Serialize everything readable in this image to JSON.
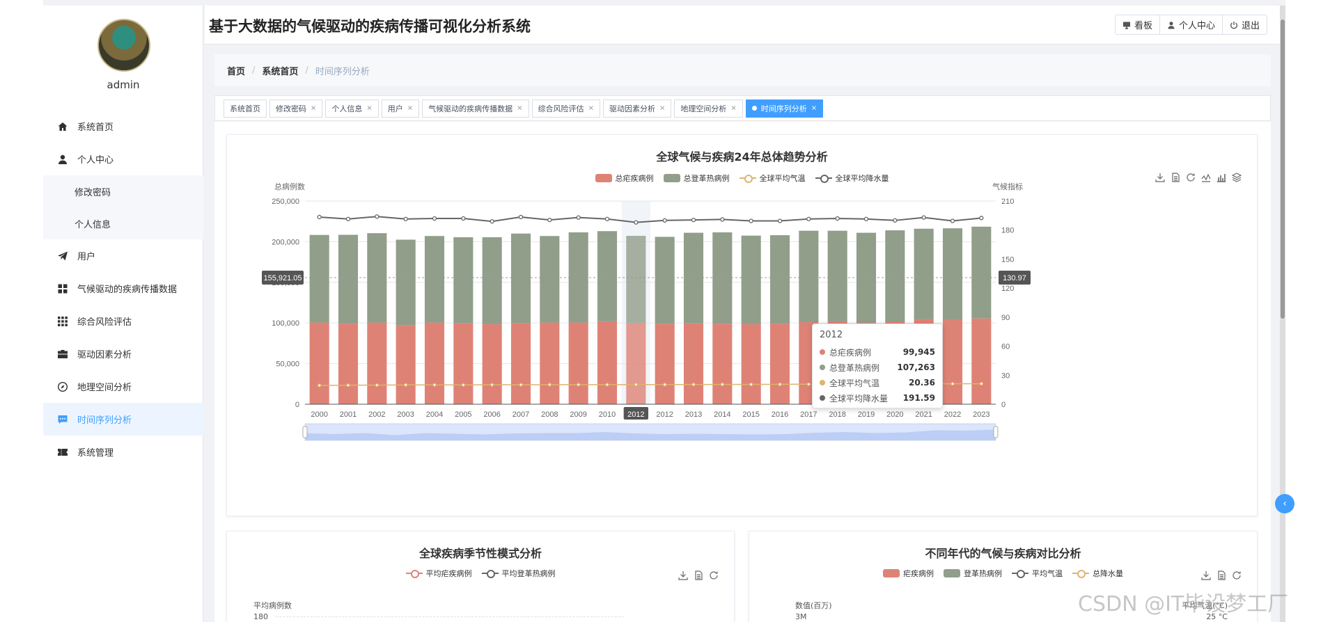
{
  "app": {
    "title": "基于大数据的气候驱动的疾病传播可视化分析系统",
    "username": "admin"
  },
  "header_buttons": [
    {
      "label": "看板",
      "icon": "monitor-icon"
    },
    {
      "label": "个人中心",
      "icon": "user-icon"
    },
    {
      "label": "退出",
      "icon": "power-icon"
    }
  ],
  "sidebar": {
    "items": [
      {
        "label": "系统首页",
        "icon": "home-icon"
      },
      {
        "label": "个人中心",
        "icon": "user-icon"
      },
      {
        "label": "修改密码",
        "sub": true
      },
      {
        "label": "个人信息",
        "sub": true
      },
      {
        "label": "用户",
        "icon": "send-icon"
      },
      {
        "label": "气候驱动的疾病传播数据",
        "icon": "grid-icon"
      },
      {
        "label": "综合风险评估",
        "icon": "apps-icon"
      },
      {
        "label": "驱动因素分析",
        "icon": "briefcase-icon"
      },
      {
        "label": "地理空间分析",
        "icon": "compass-icon"
      },
      {
        "label": "时间序列分析",
        "icon": "chat-icon",
        "active": true
      },
      {
        "label": "系统管理",
        "icon": "ticket-icon"
      }
    ]
  },
  "breadcrumb": [
    "首页",
    "系统首页",
    "时间序列分析"
  ],
  "tags": [
    {
      "label": "系统首页",
      "closable": false
    },
    {
      "label": "修改密码",
      "closable": true
    },
    {
      "label": "个人信息",
      "closable": true
    },
    {
      "label": "用户",
      "closable": true
    },
    {
      "label": "气候驱动的疾病传播数据",
      "closable": true
    },
    {
      "label": "综合风险评估",
      "closable": true
    },
    {
      "label": "驱动因素分析",
      "closable": true
    },
    {
      "label": "地理空间分析",
      "closable": true
    },
    {
      "label": "时间序列分析",
      "closable": true,
      "active": true
    }
  ],
  "tag_close": "×",
  "colors": {
    "malaria": "#df8276",
    "dengue": "#919e8a",
    "temp": "#e0b36c",
    "rain": "#666666",
    "accent": "#409eff"
  },
  "chart_data": [
    {
      "type": "bar",
      "title": "全球气候与疾病24年总体趋势分析",
      "ylabel": "总病例数",
      "y2label": "气候指标",
      "categories": [
        "2000",
        "2001",
        "2002",
        "2003",
        "2004",
        "2005",
        "2006",
        "2007",
        "2008",
        "2009",
        "2010",
        "2012",
        "2012",
        "2013",
        "2014",
        "2015",
        "2016",
        "2017",
        "2018",
        "2019",
        "2020",
        "2021",
        "2022",
        "2023"
      ],
      "ylim": [
        0,
        250000
      ],
      "y2lim": [
        0,
        210
      ],
      "yticks": [
        "0",
        "50,000",
        "100,000",
        "150,000",
        "200,000",
        "250,000"
      ],
      "y2ticks": [
        "0",
        "30",
        "60",
        "90",
        "120",
        "150",
        "180",
        "210"
      ],
      "stacked": true,
      "series": [
        {
          "name": "总疟疾病例",
          "type": "bar",
          "color": "#df8276",
          "values": [
            100500,
            99000,
            100500,
            97500,
            100500,
            99500,
            98500,
            100000,
            100500,
            100500,
            102000,
            99945,
            99000,
            99500,
            99000,
            98500,
            99000,
            101000,
            102000,
            100500,
            101500,
            104500,
            104000,
            105500
          ]
        },
        {
          "name": "总登革热病例",
          "type": "bar",
          "color": "#919e8a",
          "values": [
            107800,
            109500,
            110000,
            105000,
            106500,
            106000,
            107000,
            110000,
            106500,
            111000,
            111000,
            107263,
            107000,
            111500,
            112500,
            109000,
            109000,
            112500,
            111500,
            110500,
            112500,
            111500,
            112500,
            113000
          ]
        },
        {
          "name": "全球平均气温",
          "type": "line",
          "axis": "right",
          "color": "#e0b36c",
          "values": [
            19.5,
            19.7,
            19.8,
            20.0,
            20.0,
            20.0,
            20.1,
            20.1,
            20.2,
            20.2,
            20.2,
            20.36,
            20.3,
            20.4,
            20.5,
            20.5,
            20.6,
            20.7,
            20.8,
            20.9,
            20.9,
            21.0,
            21.1,
            21.2
          ]
        },
        {
          "name": "全球平均降水量",
          "type": "line",
          "axis": "right",
          "color": "#666666",
          "values": [
            193.5,
            191.5,
            194,
            191.5,
            192,
            192,
            189,
            193.5,
            190.5,
            193,
            191.5,
            188,
            190,
            190.5,
            191,
            189.5,
            189.5,
            191.5,
            192,
            191.5,
            190,
            193,
            189.5,
            192.5
          ]
        }
      ],
      "flags": {
        "x": "2012",
        "y_left": "155,921.05",
        "y_right": "130.97"
      },
      "tooltip": {
        "year": "2012",
        "rows": [
          {
            "name": "总疟疾病例",
            "value": "99,945",
            "color": "#df8276"
          },
          {
            "name": "总登革热病例",
            "value": "107,263",
            "color": "#919e8a"
          },
          {
            "name": "全球平均气温",
            "value": "20.36",
            "color": "#e0b36c"
          },
          {
            "name": "全球平均降水量",
            "value": "191.59",
            "color": "#666666"
          }
        ]
      },
      "legend_position": "top-center"
    },
    {
      "type": "line",
      "title": "全球疾病季节性模式分析",
      "ylabel": "平均病例数",
      "yticks": [
        "180"
      ],
      "series": [
        {
          "name": "平均疟疾病例",
          "color": "#df8276"
        },
        {
          "name": "平均登革热病例",
          "color": "#666666"
        }
      ]
    },
    {
      "type": "bar",
      "title": "不同年代的气候与疾病对比分析",
      "ylabel": "数值(百万)",
      "y2label": "平均气温(°C)",
      "yticks": [
        "3M"
      ],
      "y2ticks": [
        "25 °C"
      ],
      "series": [
        {
          "name": "疟疾病例",
          "type": "bar",
          "color": "#df8276"
        },
        {
          "name": "登革热病例",
          "type": "bar",
          "color": "#919e8a"
        },
        {
          "name": "平均气温",
          "type": "line",
          "color": "#666666"
        },
        {
          "name": "总降水量",
          "type": "line",
          "color": "#e0b36c"
        }
      ]
    }
  ],
  "watermark": "CSDN @IT毕设梦工厂",
  "side_handle_icon": "‹"
}
